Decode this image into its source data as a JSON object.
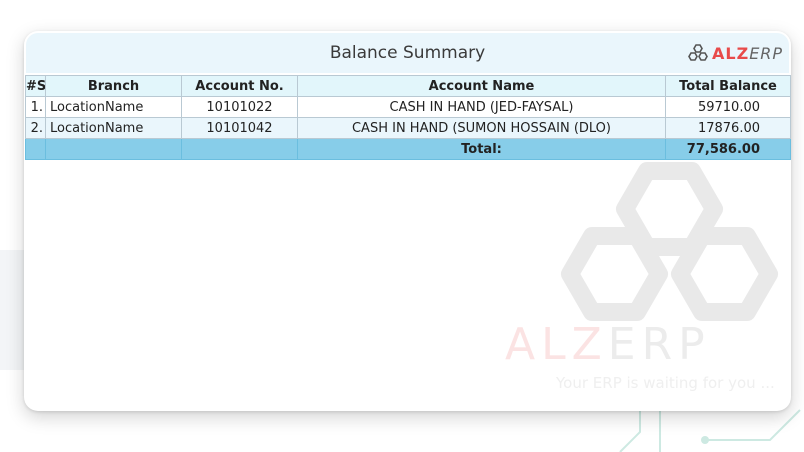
{
  "report": {
    "title": "Balance Summary",
    "logo": {
      "brand_alz": "ALZ",
      "brand_erp": "ERP"
    }
  },
  "watermark": {
    "brand_alz": "ALZ",
    "brand_erp": "ERP",
    "tagline": "Your ERP is waiting for you ..."
  },
  "table": {
    "headers": {
      "sl": "#Sl",
      "branch": "Branch",
      "account_no": "Account No.",
      "account_name": "Account Name",
      "total_balance": "Total Balance"
    },
    "rows": [
      {
        "sl": "1.",
        "branch": "LocationName",
        "account_no": "10101022",
        "account_name": "CASH IN HAND (JED-FAYSAL)",
        "total_balance": "59710.00"
      },
      {
        "sl": "2.",
        "branch": "LocationName",
        "account_no": "10101042",
        "account_name": "CASH IN HAND (SUMON HOSSAIN (DLO)",
        "total_balance": "17876.00"
      }
    ],
    "footer": {
      "label": "Total:",
      "value": "77,586.00"
    }
  },
  "colors": {
    "header_bg": "#eaf6fc",
    "total_row_bg": "#87cde9",
    "brand_red": "#e84a4a"
  }
}
